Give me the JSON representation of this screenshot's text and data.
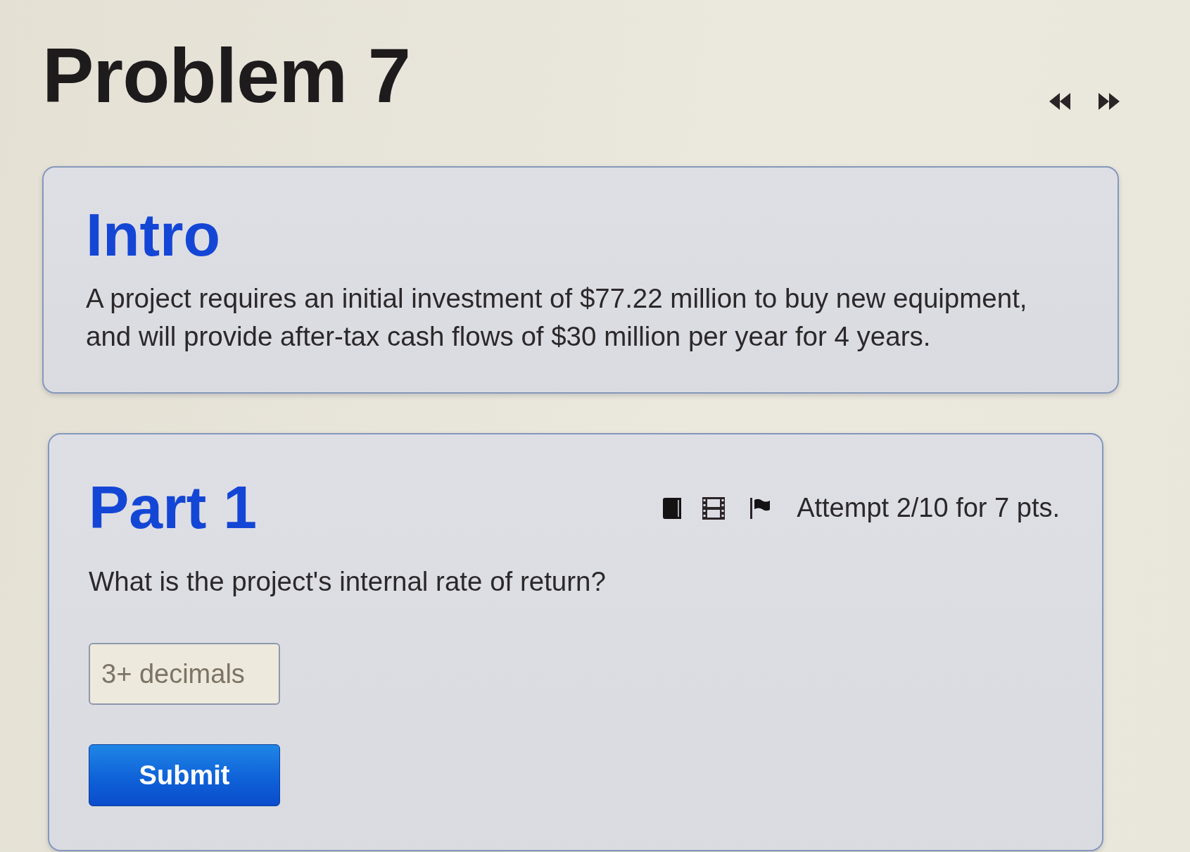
{
  "page": {
    "title": "Problem 7"
  },
  "intro": {
    "heading": "Intro",
    "text": "A project requires an initial investment of $77.22 million to buy new equipment, and will provide after-tax cash flows of $30 million per year for 4 years."
  },
  "part": {
    "heading": "Part 1",
    "attempt": "Attempt 2/10 for 7 pts.",
    "question": "What is the project's internal rate of return?",
    "answer": {
      "placeholder": "3+ decimals"
    },
    "submit": "Submit"
  }
}
